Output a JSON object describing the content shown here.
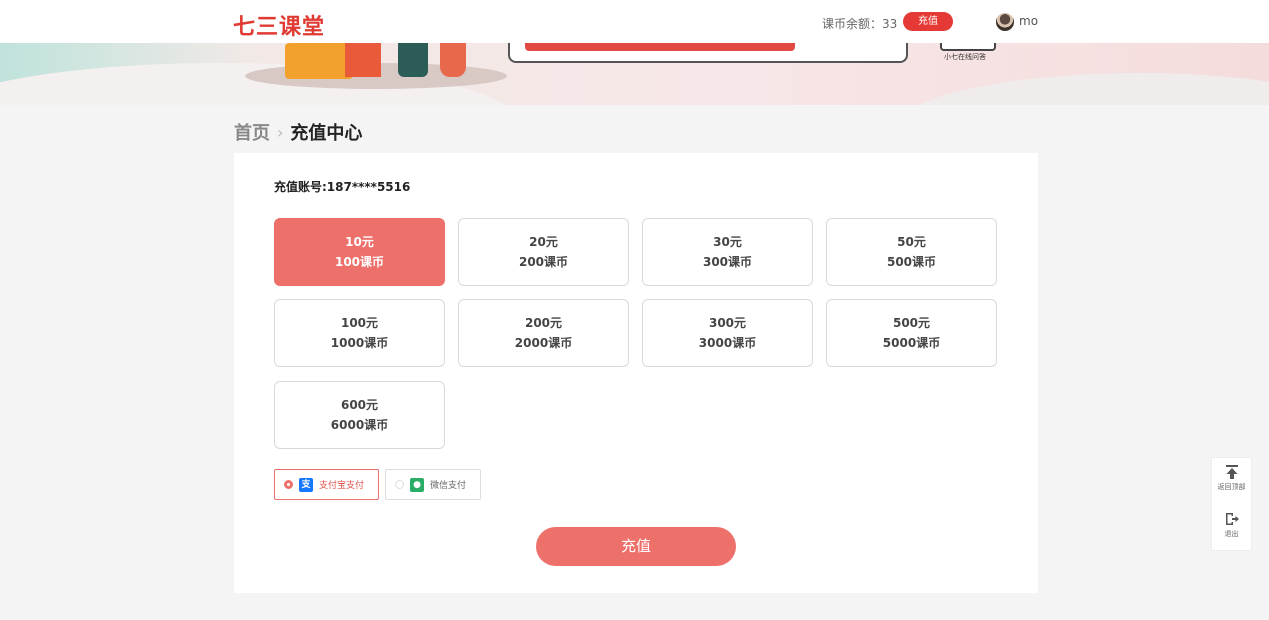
{
  "header": {
    "logo": "七三课堂",
    "balance_label": "课币余额：33",
    "recharge_button": "充值",
    "username": "mo"
  },
  "banner": {
    "badge_text": "小七在线问答"
  },
  "breadcrumb": {
    "home": "首页",
    "separator": "›",
    "current": "充值中心"
  },
  "account": {
    "label": "充值账号:187****5516"
  },
  "options": [
    {
      "price": "10元",
      "coins": "100课币",
      "selected": true
    },
    {
      "price": "20元",
      "coins": "200课币",
      "selected": false
    },
    {
      "price": "30元",
      "coins": "300课币",
      "selected": false
    },
    {
      "price": "50元",
      "coins": "500课币",
      "selected": false
    },
    {
      "price": "100元",
      "coins": "1000课币",
      "selected": false
    },
    {
      "price": "200元",
      "coins": "2000课币",
      "selected": false
    },
    {
      "price": "300元",
      "coins": "3000课币",
      "selected": false
    },
    {
      "price": "500元",
      "coins": "5000课币",
      "selected": false
    },
    {
      "price": "600元",
      "coins": "6000课币",
      "selected": false
    }
  ],
  "payment": {
    "alipay": {
      "label": "支付宝支付",
      "icon": "alipay-icon",
      "selected": true
    },
    "wechat": {
      "label": "微信支付",
      "icon": "wechat-pay-icon",
      "selected": false
    }
  },
  "submit_label": "充值",
  "sidebar": {
    "back_to_top": "返回顶部",
    "logout": "退出"
  },
  "colors": {
    "brand_red": "#e03b33",
    "accent": "#ee706b",
    "background": "#f4f4f4"
  }
}
